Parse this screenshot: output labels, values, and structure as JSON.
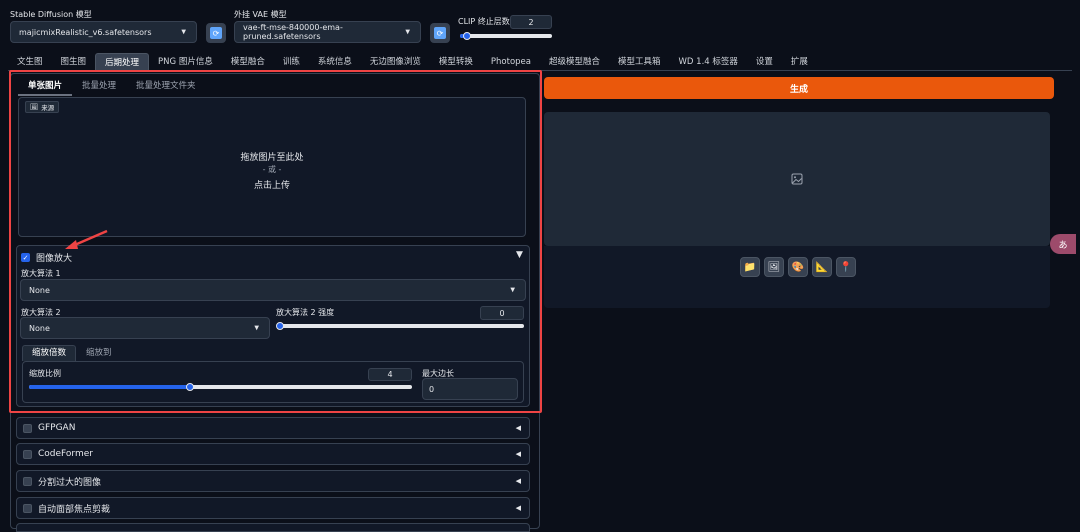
{
  "header": {
    "sd_model_label": "Stable Diffusion 模型",
    "sd_model_value": "majicmixRealistic_v6.safetensors",
    "vae_label": "外挂 VAE 模型",
    "vae_value": "vae-ft-mse-840000-ema-pruned.safetensors",
    "clip_label": "CLIP 终止层数",
    "clip_value": "2"
  },
  "tabs": [
    "文生图",
    "图生图",
    "后期处理",
    "PNG 图片信息",
    "模型融合",
    "训练",
    "系统信息",
    "无边图像浏览",
    "模型转换",
    "Photopea",
    "超级模型融合",
    "模型工具箱",
    "WD 1.4 标签器",
    "设置",
    "扩展"
  ],
  "active_tab": "后期处理",
  "subtabs": [
    "单张图片",
    "批量处理",
    "批量处理文件夹"
  ],
  "upload": {
    "source_label": "来源",
    "drop_text": "拖放图片至此处",
    "or_text": "- 或 -",
    "click_text": "点击上传"
  },
  "upscale": {
    "title": "图像放大",
    "upscaler1_label": "放大算法 1",
    "upscaler1_value": "None",
    "upscaler2_label": "放大算法 2",
    "upscaler2_value": "None",
    "upscaler2_strength_label": "放大算法 2 强度",
    "upscaler2_strength_value": "0",
    "mode_tabs": [
      "缩放倍数",
      "缩放到"
    ],
    "scale_label": "缩放比例",
    "scale_value": "4",
    "scale_fraction": 0.42,
    "max_side_label": "最大边长",
    "max_side_value": "0"
  },
  "accordions": [
    "GFPGAN",
    "CodeFormer",
    "分割过大的图像",
    "自动面部焦点剪裁"
  ],
  "generate_label": "生成",
  "colors": {
    "accent": "#ea580c",
    "highlight": "#ef4444",
    "slider": "#2563eb"
  },
  "tool_icons": [
    "folder-icon",
    "image-icon",
    "palette-icon",
    "triangle-ruler-icon",
    "pin-icon"
  ]
}
